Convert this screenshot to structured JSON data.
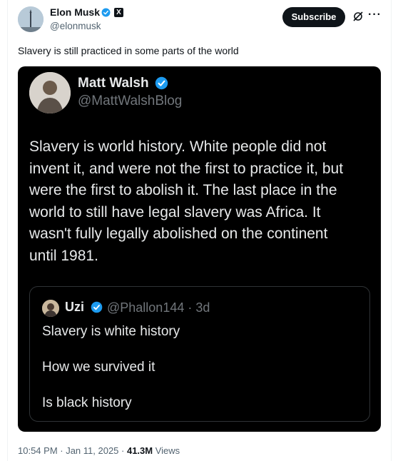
{
  "author": {
    "name": "Elon Musk",
    "handle": "@elonmusk"
  },
  "subscribe_label": "Subscribe",
  "more_label": "···",
  "tweet": {
    "text": "Slavery is still practiced in some parts of the world"
  },
  "embedded": {
    "name": "Matt Walsh",
    "handle": "@MattWalshBlog",
    "lines": [
      "Slavery is world history. White people did not",
      "invent it, and were not the first to practice it, but",
      "were the first to abolish it. The last place in the",
      "world to still have legal slavery was Africa. It",
      "wasn't fully legally abolished on the continent",
      "until 1981."
    ],
    "quote": {
      "name": "Uzi",
      "handle": "@Phallon144 · 3d",
      "line1": "Slavery is white history",
      "line2": "How we survived it",
      "line3": "Is black history"
    }
  },
  "meta": {
    "time": "10:54 PM · Jan 11, 2025 · ",
    "views_count": "41.3M",
    "views_label": " Views"
  },
  "colors": {
    "verified": "#1d9bf0",
    "image_bg": "#000000"
  },
  "icons": {
    "verified": "verified-badge-icon",
    "x": "x-logo-icon",
    "grok": "grok-icon",
    "more": "more-icon"
  }
}
